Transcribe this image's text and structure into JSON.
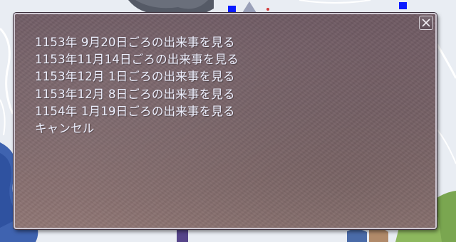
{
  "dialog": {
    "options": [
      "1153年 9月20日ごろの出来事を見る",
      "1153年11月14日ごろの出来事を見る",
      "1153年12月 1日ごろの出来事を見る",
      "1153年12月 8日ごろの出来事を見る",
      "1154年 1月19日ごろの出来事を見る",
      "キャンセル"
    ],
    "close_icon": "close-icon"
  },
  "colors": {
    "panel": "#7a6469",
    "text": "#eef0ff",
    "border": "#cfc8d2"
  }
}
